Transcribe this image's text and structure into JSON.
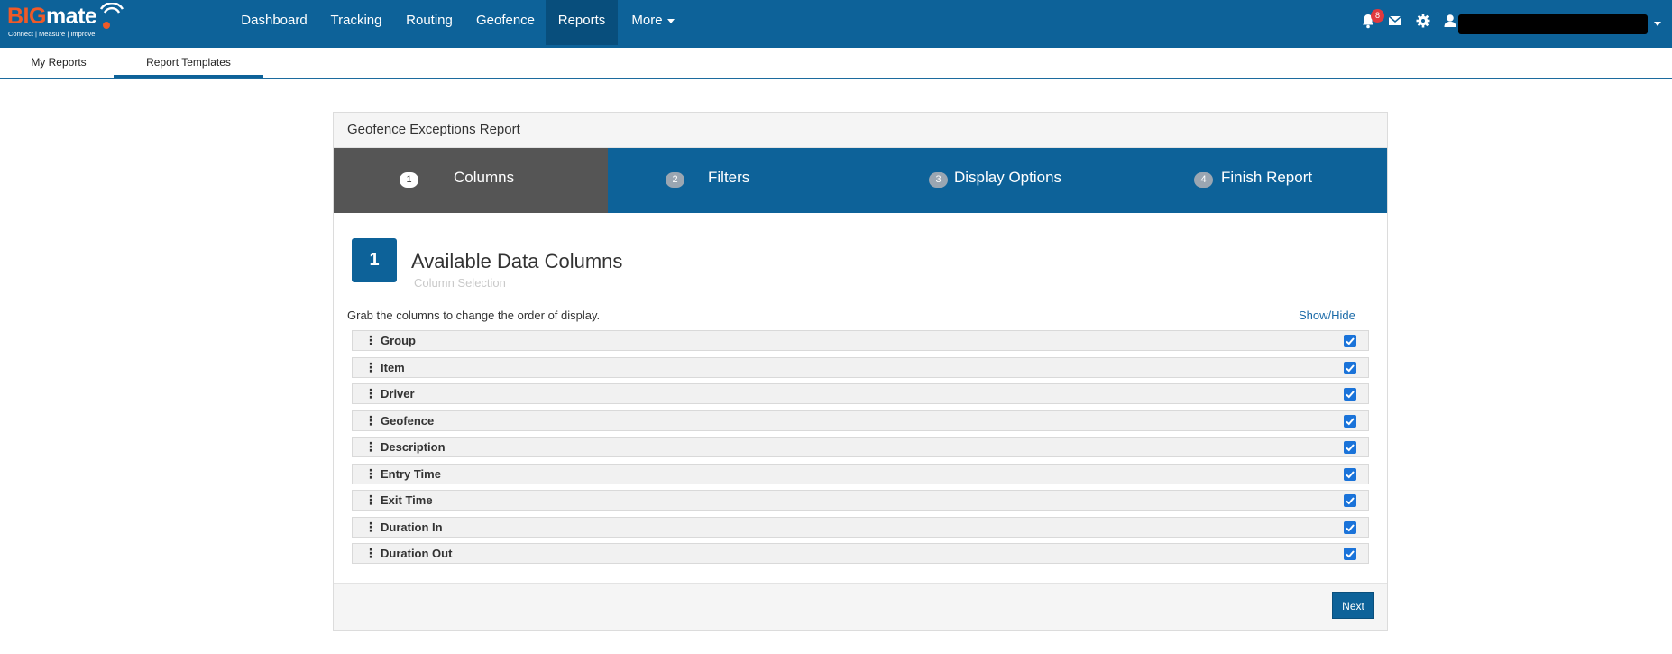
{
  "brand": {
    "logo_big": "BIG",
    "logo_mate": "mate",
    "tagline": "Connect | Measure | Improve"
  },
  "nav": {
    "items": [
      {
        "label": "Dashboard"
      },
      {
        "label": "Tracking"
      },
      {
        "label": "Routing"
      },
      {
        "label": "Geofence"
      },
      {
        "label": "Reports",
        "active": true
      },
      {
        "label": "More"
      }
    ],
    "notification_count": "8",
    "icons": [
      "bell-icon",
      "envelope-icon",
      "gear-icon",
      "user-icon"
    ]
  },
  "subtabs": {
    "items": [
      {
        "label": "My Reports"
      },
      {
        "label": "Report Templates",
        "active": true
      }
    ]
  },
  "report": {
    "title": "Geofence Exceptions Report",
    "steps": [
      {
        "num": "1",
        "label": "Columns",
        "active": true
      },
      {
        "num": "2",
        "label": "Filters"
      },
      {
        "num": "3",
        "label": "Display Options"
      },
      {
        "num": "4",
        "label": "Finish Report"
      }
    ],
    "section": {
      "num": "1",
      "title": "Available Data Columns",
      "subtitle": "Column Selection"
    },
    "hint": "Grab the columns to change the order of display.",
    "show_hide_label": "Show/Hide",
    "columns": [
      {
        "label": "Group",
        "checked": true
      },
      {
        "label": "Item",
        "checked": true
      },
      {
        "label": "Driver",
        "checked": true
      },
      {
        "label": "Geofence",
        "checked": true
      },
      {
        "label": "Description",
        "checked": true
      },
      {
        "label": "Entry Time",
        "checked": true
      },
      {
        "label": "Exit Time",
        "checked": true
      },
      {
        "label": "Duration In",
        "checked": true
      },
      {
        "label": "Duration Out",
        "checked": true
      }
    ],
    "next_label": "Next"
  },
  "colors": {
    "brand_blue": "#0d6299",
    "active_step": "#555555",
    "logo_orange": "#f05a28",
    "badge_red": "#e0393e",
    "checkbox_blue": "#1a73d9"
  }
}
